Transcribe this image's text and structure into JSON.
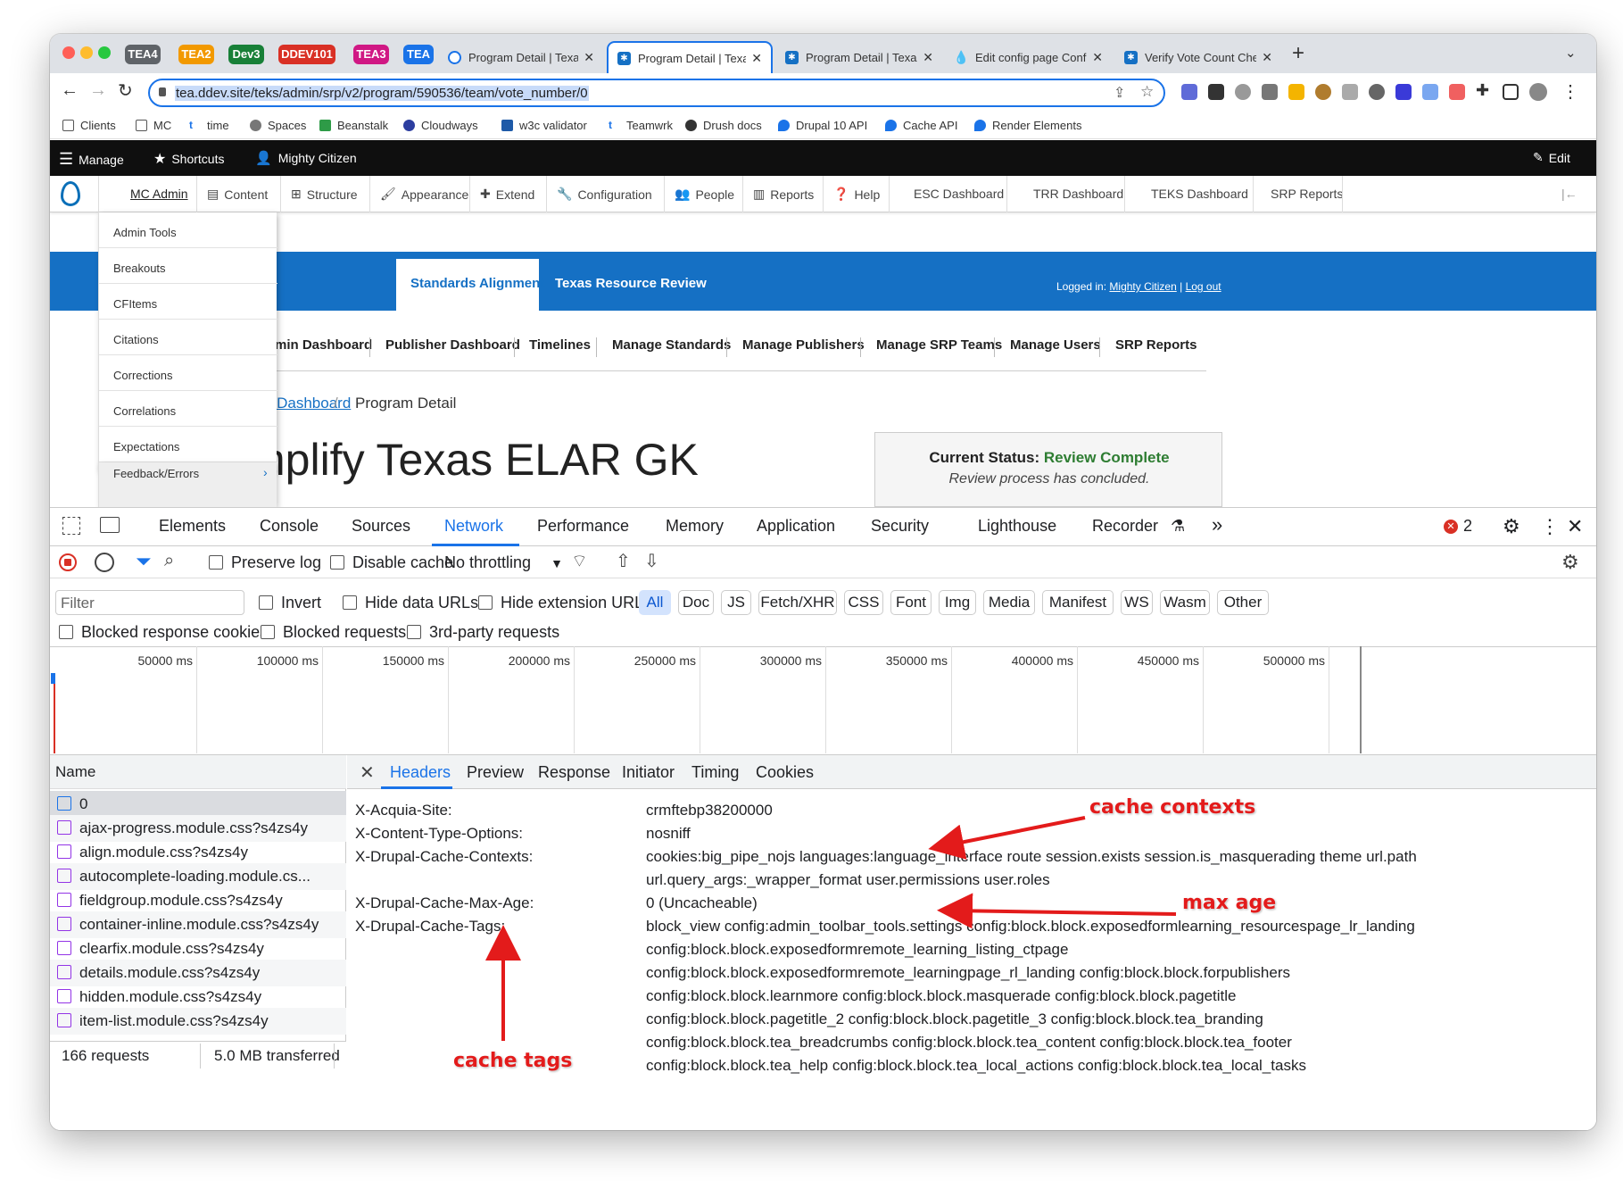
{
  "browser": {
    "tab_groups": [
      {
        "label": "TEA4",
        "color": "#5f6368"
      },
      {
        "label": "TEA2",
        "color": "#f29900"
      },
      {
        "label": "Dev3",
        "color": "#188038"
      },
      {
        "label": "DDEV101",
        "color": "#d93025"
      },
      {
        "label": "TEA3",
        "color": "#d01884"
      },
      {
        "label": "TEA",
        "color": "#1a73e8"
      }
    ],
    "tabs": [
      {
        "title": "Program Detail | Texas Res"
      },
      {
        "title": "Program Detail | Texas Res"
      },
      {
        "title": "Program Detail | Texas Res"
      },
      {
        "title": "Edit config page Configs"
      },
      {
        "title": "Verify Vote Count Checker"
      }
    ],
    "url": "tea.ddev.site/teks/admin/srp/v2/program/590536/team/vote_number/0",
    "bookmarks": [
      "Clients",
      "MC",
      "time",
      "Spaces",
      "Beanstalk",
      "Cloudways",
      "w3c validator",
      "Teamwrk",
      "Drush docs",
      "Drupal 10 API",
      "Cache API",
      "Render Elements"
    ]
  },
  "drupal": {
    "manage": "Manage",
    "shortcuts": "Shortcuts",
    "user": "Mighty Citizen",
    "edit": "Edit",
    "tray": [
      "MC Admin",
      "Content",
      "Structure",
      "Appearance",
      "Extend",
      "Configuration",
      "People",
      "Reports",
      "Help",
      "ESC Dashboard",
      "TRR Dashboard",
      "TEKS Dashboard",
      "SRP Reports"
    ],
    "dropdown": [
      "Admin Tools",
      "Breakouts",
      "CFItems",
      "Citations",
      "Corrections",
      "Correlations",
      "Expectations",
      "Feedback/Errors"
    ]
  },
  "site": {
    "tabs": [
      "Standards Alignment",
      "Texas Resource Review"
    ],
    "logged_in_label": "Logged in:",
    "logged_in_user": "Mighty Citizen",
    "logout": "Log out",
    "nav": [
      "Admin Dashboard",
      "Publisher Dashboard",
      "Timelines",
      "Manage Standards",
      "Manage Publishers",
      "Manage SRP Teams",
      "Manage Users",
      "SRP Reports"
    ],
    "breadcrumb": [
      "min Dashboard",
      "Program Detail"
    ],
    "breadcrumb_sep": "/",
    "title": "mplify Texas ELAR GK",
    "status_label": "Current Status:",
    "status_value": "Review Complete",
    "status_note": "Review process has concluded.",
    "colors": {
      "banner": "#1570c4",
      "status": "#2e7d32"
    }
  },
  "devtools": {
    "tabs": [
      "Elements",
      "Console",
      "Sources",
      "Network",
      "Performance",
      "Memory",
      "Application",
      "Security",
      "Lighthouse",
      "Recorder"
    ],
    "more": "»",
    "error_count": "2",
    "preserve_log": "Preserve log",
    "disable_cache": "Disable cache",
    "throttling": "No throttling",
    "filter_placeholder": "Filter",
    "invert": "Invert",
    "hide_data_urls": "Hide data URLs",
    "hide_extension_urls": "Hide extension URLs",
    "type_filters": [
      "All",
      "Doc",
      "JS",
      "Fetch/XHR",
      "CSS",
      "Font",
      "Img",
      "Media",
      "Manifest",
      "WS",
      "Wasm",
      "Other"
    ],
    "blocked_cookies": "Blocked response cookies",
    "blocked_requests": "Blocked requests",
    "third_party": "3rd-party requests",
    "timeline": [
      "50000 ms",
      "100000 ms",
      "150000 ms",
      "200000 ms",
      "250000 ms",
      "300000 ms",
      "350000 ms",
      "400000 ms",
      "450000 ms",
      "500000 ms"
    ],
    "name_header": "Name",
    "requests": [
      "0",
      "ajax-progress.module.css?s4zs4y",
      "align.module.css?s4zs4y",
      "autocomplete-loading.module.cs...",
      "fieldgroup.module.css?s4zs4y",
      "container-inline.module.css?s4zs4y",
      "clearfix.module.css?s4zs4y",
      "details.module.css?s4zs4y",
      "hidden.module.css?s4zs4y",
      "item-list.module.css?s4zs4y"
    ],
    "summary_requests": "166 requests",
    "summary_transferred": "5.0 MB transferred",
    "detail_tabs": [
      "Headers",
      "Preview",
      "Response",
      "Initiator",
      "Timing",
      "Cookies"
    ],
    "headers": [
      {
        "name": "X-Acquia-Site:",
        "lines": [
          "crmftebp38200000"
        ]
      },
      {
        "name": "X-Content-Type-Options:",
        "lines": [
          "nosniff"
        ]
      },
      {
        "name": "X-Drupal-Cache-Contexts:",
        "lines": [
          "cookies:big_pipe_nojs languages:language_interface route session.exists session.is_masquerading theme url.path",
          "url.query_args:_wrapper_format user.permissions user.roles"
        ]
      },
      {
        "name": "X-Drupal-Cache-Max-Age:",
        "lines": [
          "0 (Uncacheable)"
        ]
      },
      {
        "name": "X-Drupal-Cache-Tags:",
        "lines": [
          "block_view config:admin_toolbar_tools.settings config:block.block.exposedformlearning_resourcespage_lr_landing",
          "config:block.block.exposedformremote_learning_listing_ctpage",
          "config:block.block.exposedformremote_learningpage_rl_landing config:block.block.forpublishers",
          "config:block.block.learnmore config:block.block.masquerade config:block.block.pagetitle",
          "config:block.block.pagetitle_2 config:block.block.pagetitle_3 config:block.block.tea_branding",
          "config:block.block.tea_breadcrumbs config:block.block.tea_content config:block.block.tea_footer",
          "config:block.block.tea_help config:block.block.tea_local_actions config:block.block.tea_local_tasks"
        ]
      }
    ]
  },
  "annotations": {
    "cache_contexts": "cache contexts",
    "max_age": "max age",
    "cache_tags": "cache tags",
    "color": "#e31b1b"
  }
}
